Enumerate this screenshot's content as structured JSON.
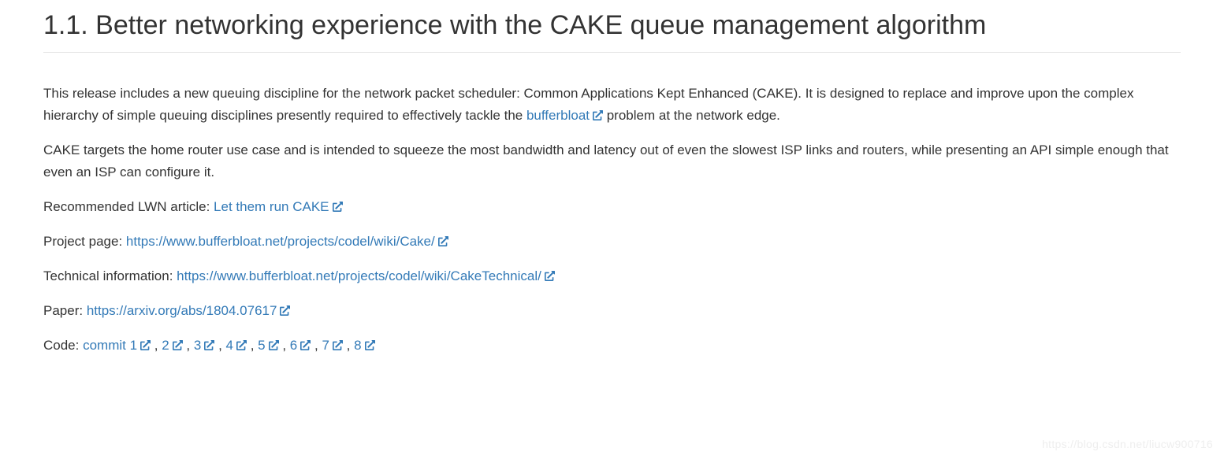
{
  "heading": "1.1. Better networking experience with the CAKE queue management algorithm",
  "para1": {
    "text_before": "This release includes a new queuing discipline for the network packet scheduler: Common Applications Kept Enhanced (CAKE). It is designed to replace and improve upon the complex hierarchy of simple queuing disciplines presently required to effectively tackle the ",
    "link_text": "bufferbloat",
    "text_after": " problem at the network edge."
  },
  "para2": "CAKE targets the home router use case and is intended to squeeze the most bandwidth and latency out of even the slowest ISP links and routers, while presenting an API simple enough that even an ISP can configure it.",
  "lwn": {
    "prefix": "Recommended LWN article: ",
    "link": "Let them run CAKE"
  },
  "project": {
    "prefix": "Project page: ",
    "link": "https://www.bufferbloat.net/projects/codel/wiki/Cake/"
  },
  "tech": {
    "prefix": "Technical information: ",
    "link": "https://www.bufferbloat.net/projects/codel/wiki/CakeTechnical/"
  },
  "paper": {
    "prefix": "Paper: ",
    "link": "https://arxiv.org/abs/1804.07617"
  },
  "code": {
    "prefix": "Code: ",
    "separator": " , ",
    "commits": [
      "commit 1",
      "2",
      "3",
      "4",
      "5",
      "6",
      "7",
      "8"
    ]
  },
  "watermark": "https://blog.csdn.net/liucw900716"
}
